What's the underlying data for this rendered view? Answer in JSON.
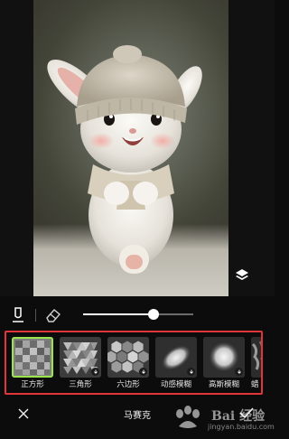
{
  "canvas": {
    "layers_icon": "layers-icon"
  },
  "tools": {
    "brush_icon": "brush-icon",
    "eraser_icon": "eraser-icon",
    "brush_size": 0.64
  },
  "effects": [
    {
      "label": "正方形",
      "icon": "square-mosaic",
      "selected": true,
      "download": false
    },
    {
      "label": "三角形",
      "icon": "triangle-mosaic",
      "selected": false,
      "download": true
    },
    {
      "label": "六边形",
      "icon": "hexagon-mosaic",
      "selected": false,
      "download": true
    },
    {
      "label": "动感模糊",
      "icon": "motion-blur",
      "selected": false,
      "download": true
    },
    {
      "label": "高斯模糊",
      "icon": "gaussian-blur",
      "selected": false,
      "download": true
    },
    {
      "label": "蜡",
      "icon": "crayon",
      "selected": false,
      "download": true
    }
  ],
  "bottom_bar": {
    "close_icon": "close-icon",
    "title": "马赛克",
    "confirm_icon": "check-icon"
  },
  "watermark": {
    "brand": "Bai 经验",
    "url": "jingyan.baidu.com"
  },
  "colors": {
    "highlight_border": "#e0353a",
    "selected_outline": "#9be44b",
    "background": "#0c0c0c"
  }
}
